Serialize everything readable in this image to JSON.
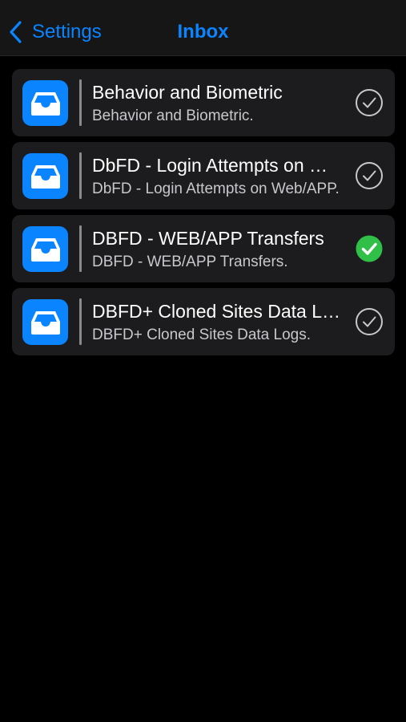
{
  "navbar": {
    "back_label": "Settings",
    "title": "Inbox"
  },
  "rows": [
    {
      "title": "Behavior and Biometric",
      "subtitle": "Behavior and Biometric.",
      "icon": "inbox-tray-icon",
      "status": "unselected"
    },
    {
      "title": "DbFD - Login Attempts on Web/APP",
      "subtitle": "DbFD - Login Attempts on Web/APP.",
      "icon": "inbox-tray-icon",
      "status": "unselected"
    },
    {
      "title": "DBFD - WEB/APP Transfers",
      "subtitle": "DBFD - WEB/APP Transfers.",
      "icon": "inbox-tray-icon",
      "status": "selected"
    },
    {
      "title": "DBFD+  Cloned Sites Data Logs",
      "subtitle": "DBFD+  Cloned Sites Data Logs.",
      "icon": "inbox-tray-icon",
      "status": "unselected"
    }
  ],
  "colors": {
    "accent": "#0a84ff",
    "app_icon": "#0a84ff",
    "selected_check": "#30c048",
    "secondary_text": "#c8c8cc",
    "unselected_ring": "#c8c8c8"
  }
}
